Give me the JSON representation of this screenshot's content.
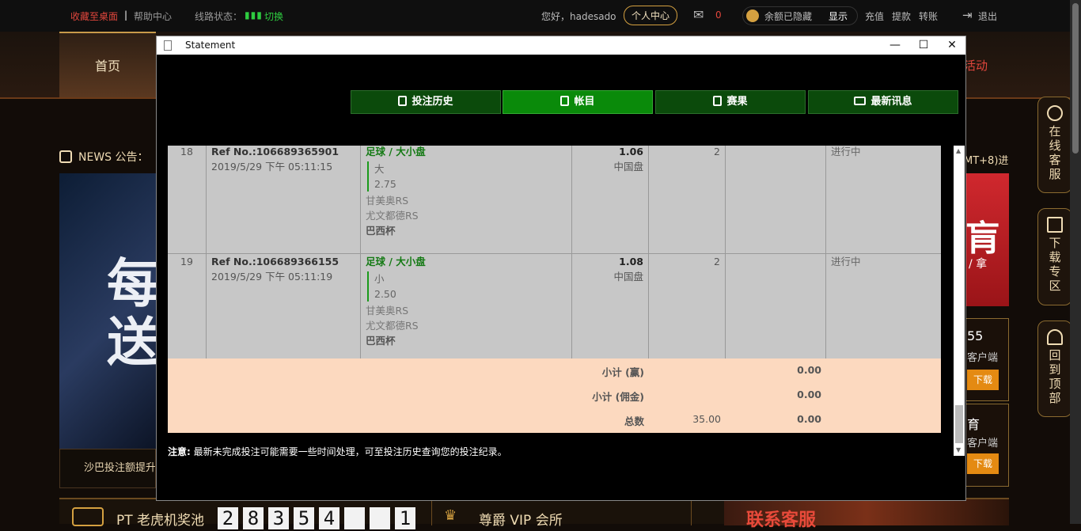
{
  "topbar": {
    "bookmark": "收藏至桌面",
    "sep": "|",
    "help": "帮助中心",
    "line_status": "线路状态：",
    "switch": "切换",
    "greeting": "您好，hadesado",
    "personal_center": "个人中心",
    "msg_count": "0",
    "balance_hidden": "余额已隐藏",
    "show": "显示",
    "deposit": "充值",
    "withdraw": "提款",
    "transfer": "转账",
    "logout": "退出"
  },
  "nav": {
    "home": "首页",
    "activity": "活动"
  },
  "news": {
    "label": "NEWS 公告：",
    "right_text": "MT+8)进"
  },
  "banner": {
    "big1": "每",
    "big2": "送",
    "footer": "沙巴投注额提升"
  },
  "right_promo": {
    "chars": "肓",
    "sub": "/ 拿"
  },
  "right_box1": {
    "title": "55",
    "sub": "客户端",
    "dl": "下载"
  },
  "right_box2": {
    "title": "育",
    "sub": "客户端",
    "dl": "下载"
  },
  "side": {
    "online_service": "在线客服",
    "download": "下载专区",
    "back_top": "回到顶部"
  },
  "bottom": {
    "pt_jackpot": "PT 老虎机奖池",
    "digits": [
      "2",
      "8",
      "3",
      "5",
      "4",
      "",
      "",
      "1"
    ],
    "vip": "尊爵 VIP 会所",
    "contact": "联系客服"
  },
  "dialog": {
    "title": "Statement",
    "minimize": "—",
    "maximize": "☐",
    "close": "✕",
    "tabs": [
      {
        "label": "投注历史",
        "active": false
      },
      {
        "label": "帐目",
        "active": true
      },
      {
        "label": "赛果",
        "active": false
      },
      {
        "label": "最新讯息",
        "active": false
      }
    ],
    "rows": [
      {
        "no": "18",
        "ref": "Ref No.:106689365901",
        "time": "2019/5/29 下午 05:11:15",
        "sport": "足球 / 大小盘",
        "pick": "大",
        "line": "2.75",
        "home": "甘美奥RS",
        "away": "尤文都德RS",
        "league": "巴西杯",
        "odds": "1.06",
        "odds_type": "中国盘",
        "stake": "2",
        "win": "",
        "status": "进行中"
      },
      {
        "no": "19",
        "ref": "Ref No.:106689366155",
        "time": "2019/5/29 下午 05:11:19",
        "sport": "足球 / 大小盘",
        "pick": "小",
        "line": "2.50",
        "home": "甘美奥RS",
        "away": "尤文都德RS",
        "league": "巴西杯",
        "odds": "1.08",
        "odds_type": "中国盘",
        "stake": "2",
        "win": "",
        "status": "进行中"
      }
    ],
    "summary": {
      "subtotal_win_label": "小计 (赢)",
      "subtotal_win": "0.00",
      "subtotal_comm_label": "小计 (佣金)",
      "subtotal_comm": "0.00",
      "total_label": "总数",
      "total_stake": "35.00",
      "total_win": "0.00"
    },
    "note_label": "注意:",
    "note": " 最新未完成投注可能需要一些时间处理，可至投注历史查询您的投注纪录。"
  },
  "colors": {
    "accent_green": "#0a8a0a",
    "summary_bg": "#fcd9bf",
    "link_red": "#e0463c"
  }
}
